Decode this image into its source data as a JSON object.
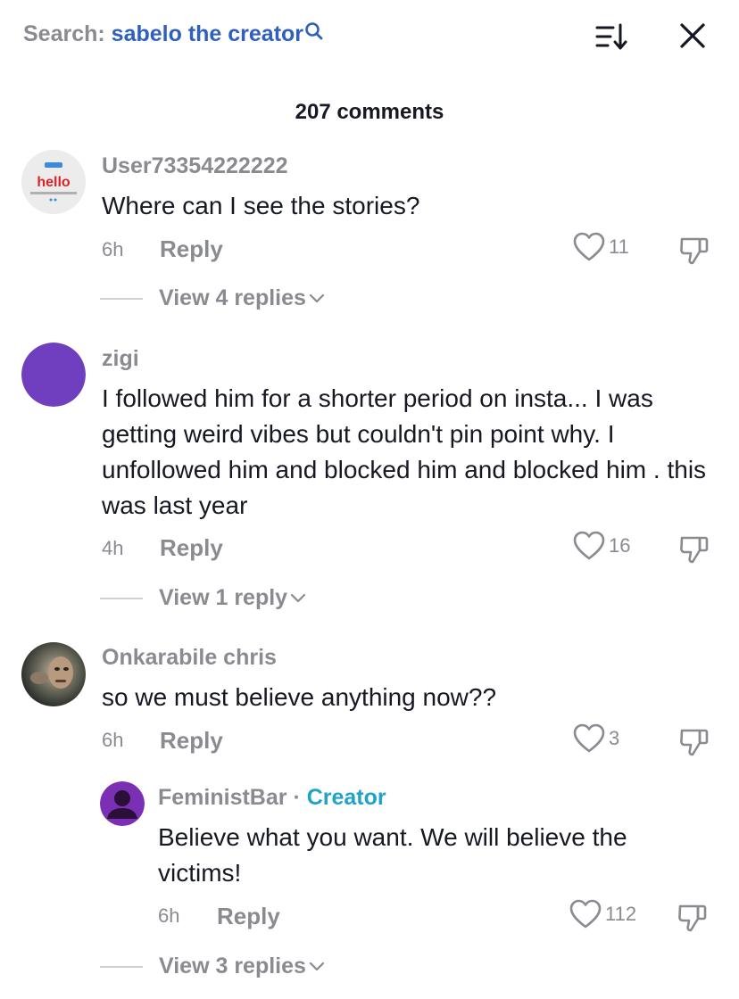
{
  "header": {
    "search_label": "Search:",
    "search_term": "sabelo the creator",
    "comment_count": "207 comments"
  },
  "comments": [
    {
      "username": "User73354222222",
      "avatar_text": "hello",
      "text": "Where can I see the stories?",
      "time": "6h",
      "reply_label": "Reply",
      "likes": "11",
      "view_replies": "View 4 replies"
    },
    {
      "username": "zigi",
      "avatar_color": "#6f3fc0",
      "text": "I followed him for a shorter period on insta... I was getting weird vibes but couldn't pin point why. I unfollowed him and blocked him and blocked him . this was last year",
      "time": "4h",
      "reply_label": "Reply",
      "likes": "16",
      "view_replies": "View 1 reply"
    },
    {
      "username": "Onkarabile chris",
      "text": "so we must believe anything now??",
      "time": "6h",
      "reply_label": "Reply",
      "likes": "3",
      "reply": {
        "username": "FeministBar",
        "separator": "·",
        "badge": "Creator",
        "avatar_color": "#7b2fb5",
        "text": "Believe what you want. We will believe the victims!",
        "time": "6h",
        "reply_label": "Reply",
        "likes": "112"
      },
      "view_replies": "View 3 replies"
    }
  ],
  "colors": {
    "accent_blue": "#2f5fbf",
    "creator_badge": "#20a3c9",
    "muted_text": "#8a8b91",
    "body_text": "#161823"
  },
  "icons": [
    "search-icon",
    "sort-icon",
    "close-icon",
    "heart-icon",
    "dislike-icon",
    "chevron-down-icon"
  ]
}
